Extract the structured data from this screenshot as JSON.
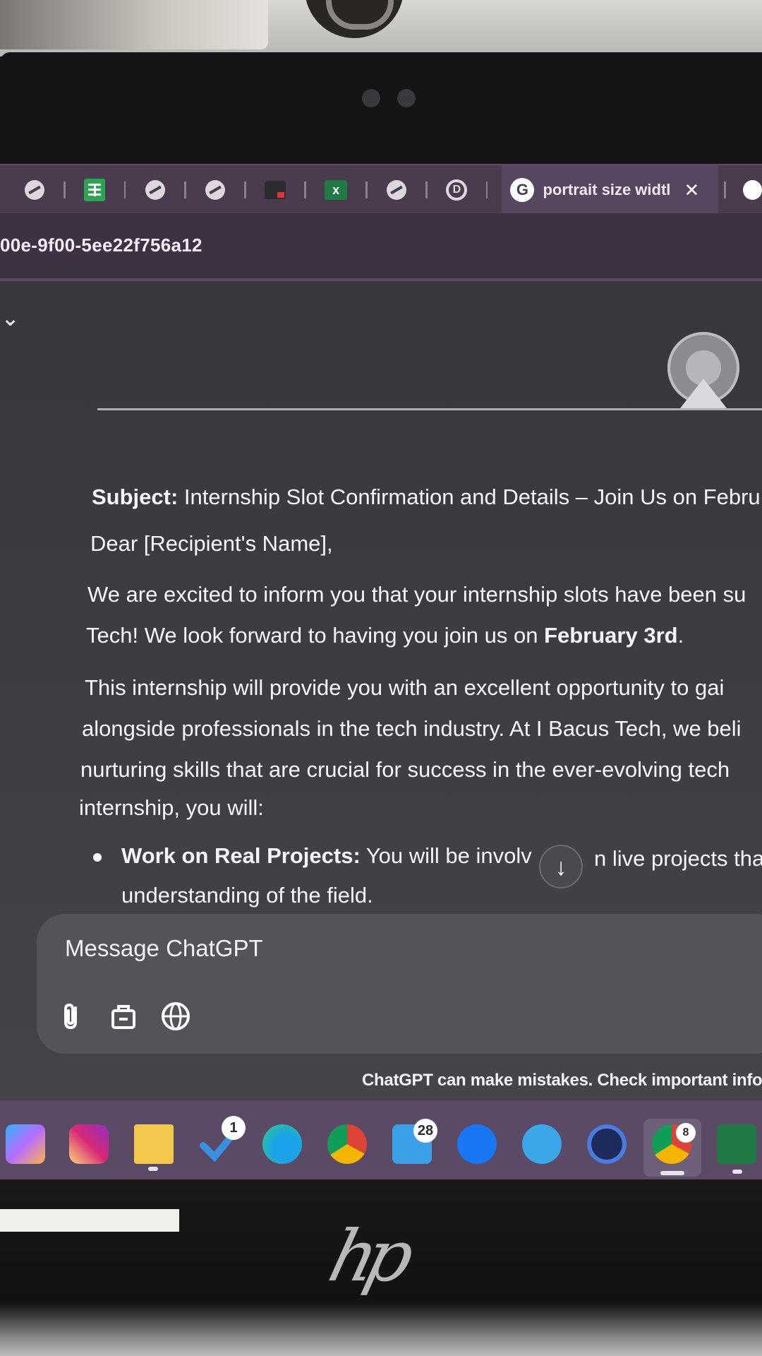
{
  "browser": {
    "tab_title": "portrait size widtl",
    "tab_close": "✕",
    "url_fragment": "00e-9f00-5ee22f756a12",
    "tabs": [
      {
        "icon": "globe-icon"
      },
      {
        "icon": "sheets-icon"
      },
      {
        "icon": "globe-icon"
      },
      {
        "icon": "globe-icon"
      },
      {
        "icon": "form-icon"
      },
      {
        "icon": "excel-icon"
      },
      {
        "icon": "globe-icon"
      },
      {
        "icon": "d-icon"
      }
    ]
  },
  "chat": {
    "subject_label": "Subject:",
    "subject_text": "Internship Slot Confirmation and Details – Join Us on Febru",
    "greeting": "Dear [Recipient's Name],",
    "para1_line1": "We are excited to inform you that your internship slots have been su",
    "para1_line2_a": "Tech! We look forward to having you join us on ",
    "para1_line2_b": "February 3rd",
    "para1_line2_c": ".",
    "para2_line1": "This internship will provide you with an excellent opportunity to gai",
    "para2_line2": "alongside professionals in the tech industry. At I Bacus Tech, we beli",
    "para2_line3": "nurturing skills that are crucial for success in the ever-evolving tech",
    "para2_line4": "internship, you will:",
    "bullet1_title": "Work on Real Projects:",
    "bullet1_text_a": " You will be involv",
    "bullet1_text_b": "n live projects that",
    "bullet1_line2": "understanding of the field.",
    "scroll_down_glyph": "↓"
  },
  "composer": {
    "placeholder": "Message ChatGPT"
  },
  "disclaimer": "ChatGPT can make mistakes. Check important info.",
  "taskbar": {
    "badges": {
      "store": "1",
      "linkedin": "28",
      "chrome": "8"
    }
  },
  "colors": {
    "tab_bar": "#4a3b4f",
    "chat_bg": "#3d3c42",
    "composer_bg": "#54535a",
    "taskbar": "#5a4a66"
  }
}
